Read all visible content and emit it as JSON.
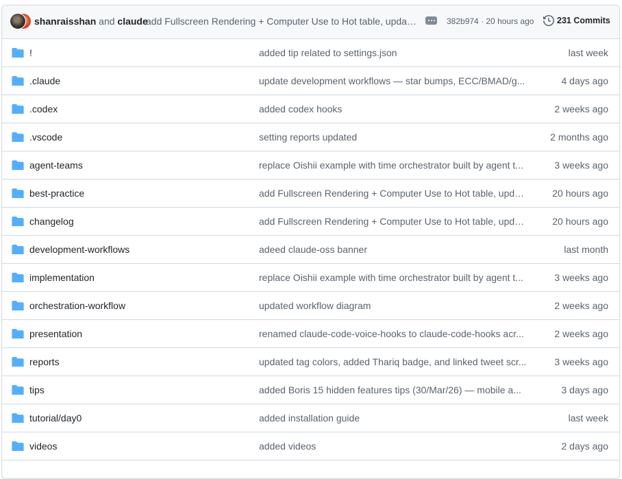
{
  "commit": {
    "author1": "shanraisshan",
    "and_text": "and",
    "author2": "claude",
    "message": "add Fullscreen Rendering + Computer Use to Hot table, updat...",
    "sha_time": "382b974 · 20 hours ago",
    "commits_count": "231 Commits"
  },
  "colors": {
    "folder": "#54aeff",
    "muted": "#59636e"
  },
  "rows": [
    {
      "name": "!",
      "message": "added tip related to settings.json",
      "age": "last week"
    },
    {
      "name": ".claude",
      "message": "update development workflows — star bumps, ECC/BMAD/g...",
      "age": "4 days ago"
    },
    {
      "name": ".codex",
      "message": "added codex hooks",
      "age": "2 weeks ago"
    },
    {
      "name": ".vscode",
      "message": "setting reports updated",
      "age": "2 months ago"
    },
    {
      "name": "agent-teams",
      "message": "replace Oishii example with time orchestrator built by agent t...",
      "age": "3 weeks ago"
    },
    {
      "name": "best-practice",
      "message": "add Fullscreen Rendering + Computer Use to Hot table, upda...",
      "age": "20 hours ago"
    },
    {
      "name": "changelog",
      "message": "add Fullscreen Rendering + Computer Use to Hot table, upda...",
      "age": "20 hours ago"
    },
    {
      "name": "development-workflows",
      "message": "adeed claude-oss banner",
      "age": "last month"
    },
    {
      "name": "implementation",
      "message": "replace Oishii example with time orchestrator built by agent t...",
      "age": "3 weeks ago"
    },
    {
      "name": "orchestration-workflow",
      "message": "updated workflow diagram",
      "age": "2 weeks ago"
    },
    {
      "name": "presentation",
      "message": "renamed claude-code-voice-hooks to claude-code-hooks acr...",
      "age": "2 weeks ago"
    },
    {
      "name": "reports",
      "message": "updated tag colors, added Thariq badge, and linked tweet scr...",
      "age": "3 weeks ago"
    },
    {
      "name": "tips",
      "message": "added Boris 15 hidden features tips (30/Mar/26) — mobile a...",
      "age": "3 days ago"
    },
    {
      "name": "tutorial/day0",
      "message": "added installation guide",
      "age": "last week"
    },
    {
      "name": "videos",
      "message": "added videos",
      "age": "2 days ago"
    }
  ]
}
